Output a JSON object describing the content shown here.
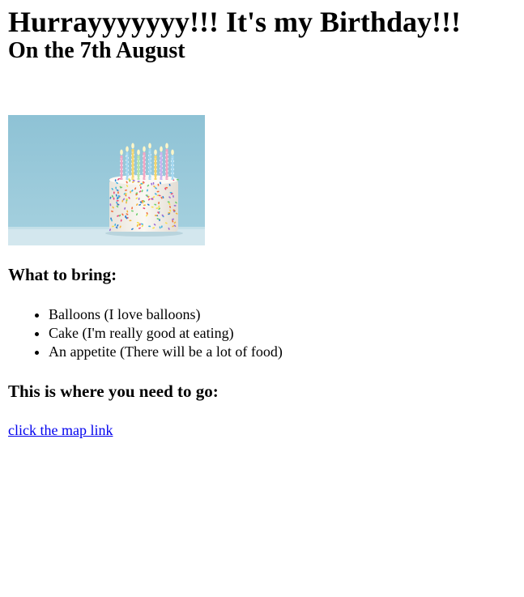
{
  "page": {
    "heading": "Hurrayyyyyyy!!! It's my Birthday!!!",
    "date_heading": "On the 7th August"
  },
  "image": {
    "description_icon": "birthday-cake-image",
    "colors": {
      "sky_top": "#8fc3d6",
      "sky_bottom": "#a9d3e1",
      "table": "#d9eaf0",
      "cake": "#f6f3ee"
    }
  },
  "bring": {
    "title": "What to bring:",
    "items": [
      "Balloons (I love balloons)",
      "Cake (I'm really good at eating)",
      "An appetite (There will be a lot of food)"
    ]
  },
  "location": {
    "title": "This is where you need to go:",
    "link_text": "click the map link"
  },
  "colors": {
    "link": "#0000ee",
    "text": "#000000",
    "background": "#ffffff"
  }
}
